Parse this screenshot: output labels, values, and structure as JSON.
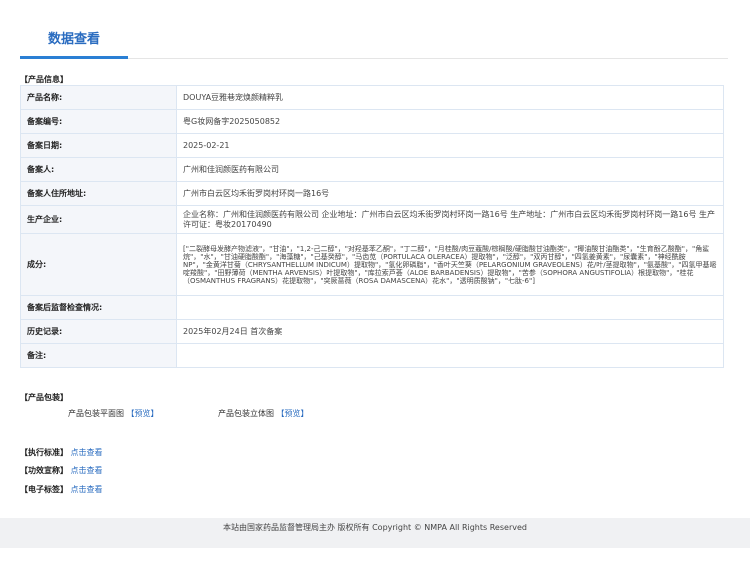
{
  "tab": {
    "label": "数据查看"
  },
  "sections": {
    "product_info": "【产品信息】",
    "packaging": "【产品包装】",
    "standard": "【执行标准】",
    "efficacy": "【功效宣称】",
    "label": "【电子标签】"
  },
  "rows": [
    {
      "key": "产品名称:",
      "value": "DOUYA豆雅巷宠焕颜精粹乳"
    },
    {
      "key": "备案编号:",
      "value": "粤G妆网备字2025050852"
    },
    {
      "key": "备案日期:",
      "value": "2025-02-21"
    },
    {
      "key": "备案人:",
      "value": "广州和佳润颜医药有限公司"
    },
    {
      "key": "备案人住所地址:",
      "value": "广州市白云区均禾街罗岗村环岗一路16号"
    },
    {
      "key": "生产企业:",
      "value": "企业名称：广州和佳润颜医药有限公司 企业地址：广州市白云区均禾街罗岗村环岗一路16号 生产地址：广州市白云区均禾街罗岗村环岗一路16号 生产许可证：粤妆20170490"
    },
    {
      "key": "成分:",
      "value": "[\"二裂酵母发酵产物滤液\"，\"甘油\"，\"1,2-己二醇\"，\"对羟基苯乙酮\"，\"丁二醇\"，\"月桂酸/肉豆蔻酸/棕榈酸/硬脂酸甘油酯类\"，\"椰油酸甘油酯类\"，\"生育酚乙酸酯\"，\"角鲨烷\"，\"水\"，\"甘油硬脂酸酯\"，\"海藻糖\"，\"己基癸醇\"，\"马齿苋（PORTULACA OLERACEA）提取物\"，\"泛醇\"，\"双丙甘醇\"，\"四氢姜黄素\"，\"尿囊素\"，\"神经酰胺 NP\"，\"金黄洋甘菊（CHRYSANTHELLUM INDICUM）提取物\"，\"氢化卵磷脂\"，\"香叶天竺葵（PELARGONIUM GRAVEOLENS）花/叶/茎提取物\"，\"氨基酸\"，\"四氢甲基嘧啶羧酸\"，\"田野薄荷（MENTHA ARVENSIS）叶提取物\"，\"库拉索芦荟（ALOE BARBADENSIS）提取物\"，\"苦参（SOPHORA ANGUSTIFOLIA）根提取物\"，\"桂花（OSMANTHUS FRAGRANS）花提取物\"，\"突厥蔷薇（ROSA DAMASCENA）花水\"，\"透明质酸钠\"，\"七肽-6\"]"
    },
    {
      "key": "备案后监督检查情况:",
      "value": ""
    },
    {
      "key": "历史记录:",
      "value": "2025年02月24日 首次备案"
    },
    {
      "key": "备注:",
      "value": ""
    }
  ],
  "packaging": {
    "flat_label": "产品包装平面图",
    "flat_link": "【预览】",
    "solid_label": "产品包装立体图",
    "solid_link": "【预览】"
  },
  "view_link": "点击查看",
  "footer": "本站由国家药品监督管理局主办 版权所有 Copyright © NMPA All Rights Reserved"
}
